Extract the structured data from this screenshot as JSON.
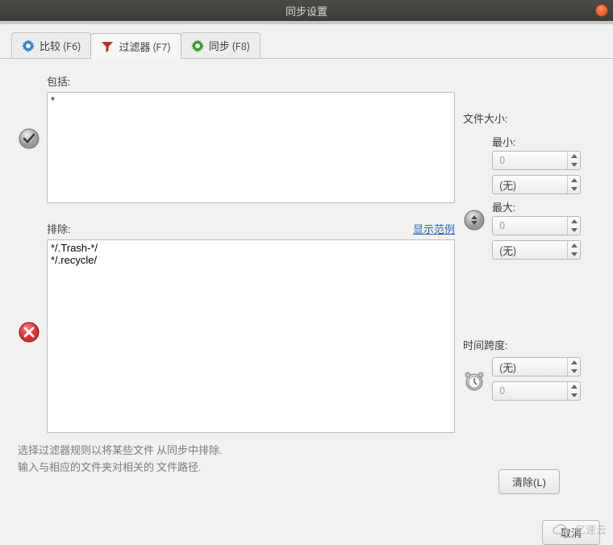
{
  "window": {
    "title": "同步设置"
  },
  "tabs": [
    {
      "label": "比较 (F6)"
    },
    {
      "label": "过滤器 (F7)"
    },
    {
      "label": "同步 (F8)"
    }
  ],
  "include": {
    "label": "包括:",
    "value": "*"
  },
  "exclude": {
    "label": "排除:",
    "example_link": "显示范例",
    "value": "*/.Trash-*/\n*/.recycle/"
  },
  "hint": {
    "line1": "选择过滤器规则以将某些文件 从同步中排除.",
    "line2": "输入与相应的文件夹对相关的 文件路径."
  },
  "filesize": {
    "title": "文件大小:",
    "min_label": "最小:",
    "min_value": "0",
    "min_unit": "(无)",
    "max_label": "最大:",
    "max_value": "0",
    "max_unit": "(无)"
  },
  "timespan": {
    "title": "时间跨度:",
    "unit": "(无)",
    "value": "0"
  },
  "buttons": {
    "clear": "清除(L)",
    "cancel": "取消"
  },
  "watermark": "亿速云"
}
